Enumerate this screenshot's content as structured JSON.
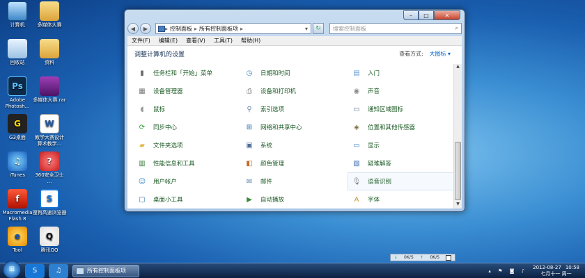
{
  "desktop": {
    "icons": [
      {
        "label": "计算机",
        "icon": "computer-icon"
      },
      {
        "label": "多媒体大赛",
        "icon": "folder-icon"
      },
      {
        "label": "回收站",
        "icon": "recycle-bin-icon"
      },
      {
        "label": "资料",
        "icon": "folder-icon"
      },
      {
        "label": "Adobe Photosh...",
        "icon": "photoshop-icon",
        "glyph": "Ps"
      },
      {
        "label": "多媒体大赛.rar",
        "icon": "rar-archive-icon"
      },
      {
        "label": "G3桌面",
        "icon": "g3-icon",
        "glyph": "G"
      },
      {
        "label": "教学大赛设计 算术教学...",
        "icon": "word-document-icon",
        "glyph": "W"
      },
      {
        "label": "iTunes",
        "icon": "itunes-icon",
        "glyph": "♫"
      },
      {
        "label": "360安全卫士 ...",
        "icon": "security-guard-icon",
        "glyph": "?"
      },
      {
        "label": "Macromedia Flash 8",
        "icon": "flash-icon",
        "glyph": "f"
      },
      {
        "label": "搜狗高速浏览器",
        "icon": "sogou-browser-icon",
        "glyph": "S"
      },
      {
        "label": "Tool",
        "icon": "ie-icon",
        "glyph": "e"
      },
      {
        "label": "腾讯QQ",
        "icon": "qq-icon",
        "glyph": "Q"
      }
    ]
  },
  "window": {
    "controls": {
      "minimize": "–",
      "maximize": "□",
      "close": "✕"
    },
    "nav": {
      "back": "◀",
      "forward": "▶"
    },
    "address": {
      "crumbs": [
        "控制面板",
        "所有控制面板项"
      ],
      "separator": "▸",
      "dropdown": "▾"
    },
    "refresh": "↻",
    "search": {
      "placeholder": "搜索控制面板",
      "icon": "⌕"
    },
    "menu": [
      "文件(F)",
      "编辑(E)",
      "查看(V)",
      "工具(T)",
      "帮助(H)"
    ],
    "title": "调整计算机的设置",
    "view_by_label": "查看方式:",
    "view_by_value": "大图标 ▾",
    "items": [
      {
        "label": "任务栏和「开始」菜单",
        "icon": "taskbar-icon",
        "color": "#6b6b6b",
        "glyph": "▮"
      },
      {
        "label": "日期和时间",
        "icon": "clock-icon",
        "color": "#3d7fc4",
        "glyph": "◷"
      },
      {
        "label": "入门",
        "icon": "getting-started-icon",
        "color": "#5d9ad8",
        "glyph": "▤"
      },
      {
        "label": "设备管理器",
        "icon": "device-manager-icon",
        "color": "#7a7a7a",
        "glyph": "▦"
      },
      {
        "label": "设备和打印机",
        "icon": "printer-icon",
        "color": "#6c6c6c",
        "glyph": "⎙"
      },
      {
        "label": "声音",
        "icon": "speaker-icon",
        "color": "#8c8c8c",
        "glyph": "◉"
      },
      {
        "label": "鼠标",
        "icon": "mouse-icon",
        "color": "#9a9a9a",
        "glyph": "◖"
      },
      {
        "label": "索引选项",
        "icon": "magnifier-icon",
        "color": "#6a8ab0",
        "glyph": "⚲"
      },
      {
        "label": "通知区域图标",
        "icon": "notification-area-icon",
        "color": "#4b6a8e",
        "glyph": "▭"
      },
      {
        "label": "同步中心",
        "icon": "sync-center-icon",
        "color": "#2e9b2e",
        "glyph": "⟳"
      },
      {
        "label": "网络和共享中心",
        "icon": "network-icon",
        "color": "#2b6cb3",
        "glyph": "⊞"
      },
      {
        "label": "位置和其他传感器",
        "icon": "location-sensor-icon",
        "color": "#7d6a3c",
        "glyph": "◈"
      },
      {
        "label": "文件夹选项",
        "icon": "folder-options-icon",
        "color": "#e1b441",
        "glyph": "▰"
      },
      {
        "label": "系统",
        "icon": "system-icon",
        "color": "#4f6e9a",
        "glyph": "▣"
      },
      {
        "label": "显示",
        "icon": "display-icon",
        "color": "#2f76c2",
        "glyph": "▭"
      },
      {
        "label": "性能信息和工具",
        "icon": "performance-icon",
        "color": "#3d7d3d",
        "glyph": "▥"
      },
      {
        "label": "颜色管理",
        "icon": "color-management-icon",
        "color": "#c86a2b",
        "glyph": "◧"
      },
      {
        "label": "疑难解答",
        "icon": "troubleshooting-icon",
        "color": "#3f6eb0",
        "glyph": "▧"
      },
      {
        "label": "用户帐户",
        "icon": "user-accounts-icon",
        "color": "#3a85c8",
        "glyph": "☺"
      },
      {
        "label": "邮件",
        "icon": "mail-icon",
        "color": "#5a7fa8",
        "glyph": "✉"
      },
      {
        "label": "语音识别",
        "icon": "microphone-icon",
        "color": "#8a8a8a",
        "glyph": "🎙"
      },
      {
        "label": "桌面小工具",
        "icon": "desktop-gadgets-icon",
        "color": "#3b74b3",
        "glyph": "▢"
      },
      {
        "label": "自动播放",
        "icon": "autoplay-icon",
        "color": "#3d8b3d",
        "glyph": "▶"
      },
      {
        "label": "字体",
        "icon": "fonts-icon",
        "color": "#c89a2b",
        "glyph": "A"
      }
    ],
    "selected_index": 20,
    "scroll": {
      "up": "▲",
      "down": "▼"
    }
  },
  "netmeter": {
    "down_arrow": "↓",
    "down_value": "0K/S",
    "up_arrow": "↑",
    "up_value": "0K/S"
  },
  "taskbar": {
    "start_glyph": "⊞",
    "pinned": [
      {
        "icon": "sogou-icon",
        "glyph": "S",
        "color": "#1877d6"
      },
      {
        "icon": "itunes-taskbar-icon",
        "glyph": "♫",
        "color": "#2d7fd0"
      }
    ],
    "task_label": "所有控制面板项",
    "tray_icons": "▴ ⚑ ◙ ♪",
    "time": "10:58",
    "date": "2012-08-27",
    "weekday": "七月十一 周一"
  }
}
